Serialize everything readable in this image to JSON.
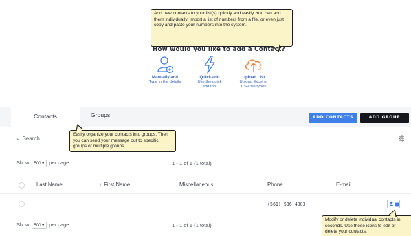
{
  "tooltips": {
    "add_intro": "Add new contacts to your list(s) quickly and easily. You can add them individually, import a list of numbers from a file, or even just copy and paste your numbers into the system.",
    "groups": "Easily organize your contacts into groups. Then you can send your message out to specific groups or multiple groups.",
    "actions": "Modify or delete individual contacts in seconds. Use these icons to edit or delete your contacts."
  },
  "chooser": {
    "question": "How would you like to add a Contact?",
    "options": [
      {
        "title": "Manually add",
        "desc": "Type in the details",
        "icon": "person-plus-icon"
      },
      {
        "title": "Quick add",
        "desc": "Use the quick add tool",
        "icon": "lightning-icon"
      },
      {
        "title": "Upload List",
        "desc": "Upload Excel or CSV file types",
        "icon": "cloud-upload-icon"
      }
    ]
  },
  "tabs": [
    {
      "label": "Contacts",
      "active": true
    },
    {
      "label": "Groups",
      "active": false
    }
  ],
  "buttons": {
    "add_contacts": "ADD CONTACTS",
    "add_group": "ADD GROUP"
  },
  "search": {
    "placeholder": "Search"
  },
  "pager": {
    "show": "Show",
    "per_page_value": "500 ▾",
    "per_page": "per page",
    "range": "1 - 1 of 1 (1 total)"
  },
  "table": {
    "columns": [
      "Last Name",
      "↓ First Name",
      "Miscellaneous",
      "Phone",
      "E-mail"
    ],
    "rows": [
      {
        "last": "",
        "first": "",
        "misc": "",
        "phone": "(561) 536-4803",
        "email": ""
      }
    ]
  },
  "colors": {
    "accent": "#3f7fe8",
    "dark_button": "#15171c",
    "tooltip_bg": "#fbf4c9",
    "link_blue": "#3763b7"
  }
}
